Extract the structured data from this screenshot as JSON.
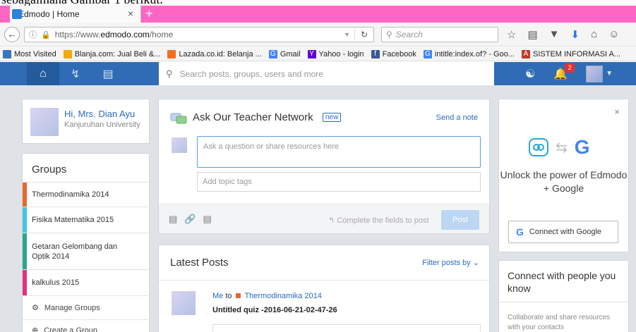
{
  "caption": "sebagaimana Gambar 1 berikut.",
  "browser": {
    "tab_title": "Edmodo | Home",
    "tab_close": "×",
    "new_tab": "+",
    "url_prefix": "https://www.",
    "url_domain": "edmodo.com",
    "url_path": "/home",
    "search_placeholder": "Search",
    "bookmarks": [
      {
        "label": "Most Visited",
        "color": "#3b73c7"
      },
      {
        "label": "Blanja.com: Jual Beli &...",
        "color": "#f2a900"
      },
      {
        "label": "Lazada.co.id: Belanja ...",
        "color": "#f36f21"
      },
      {
        "label": "Gmail",
        "color": "#4285f4"
      },
      {
        "label": "Yahoo - login",
        "color": "#5f01d1"
      },
      {
        "label": "Facebook",
        "color": "#3b5998"
      },
      {
        "label": "intitle:index.of? - Goo...",
        "color": "#4285f4"
      },
      {
        "label": "SISTEM INFORMASI A...",
        "color": "#c0392b"
      }
    ]
  },
  "edmodo_nav": {
    "search_placeholder": "Search posts, groups, users and more",
    "notification_count": "2"
  },
  "profile": {
    "name": "Hi, Mrs. Dian Ayu",
    "school": "Kanjuruhan University"
  },
  "groups": {
    "title": "Groups",
    "items": [
      {
        "label": "Thermodinamika 2014",
        "color": "#e9672f"
      },
      {
        "label": "Fisika Matematika 2015",
        "color": "#3fc7e6"
      },
      {
        "label": "Getaran Gelombang dan Optik 2014",
        "color": "#2aa68a"
      },
      {
        "label": "kalkulus 2015",
        "color": "#e6307f"
      }
    ],
    "manage": "Manage Groups",
    "create": "Create a Group"
  },
  "composer": {
    "title": "Ask Our Teacher Network",
    "new_badge": "new",
    "send_note": "Send a note",
    "ask_placeholder": "Ask a question or share resources here",
    "topic_placeholder": "Add topic tags",
    "complete_hint": "Complete the fields to post",
    "post_button": "Post"
  },
  "latest": {
    "title": "Latest Posts",
    "filter": "Filter posts by",
    "post": {
      "author": "Me",
      "to": "to",
      "group": "Thermodinamika 2014",
      "title": "Untitled quiz -2016-06-21-02-47-26"
    }
  },
  "google_card": {
    "close": "×",
    "headline": "Unlock the power of Edmodo + Google",
    "button": "Connect with Google"
  },
  "connect_card": {
    "title": "Connect with people you know",
    "text": "Collaborate and share resources with your contacts"
  }
}
